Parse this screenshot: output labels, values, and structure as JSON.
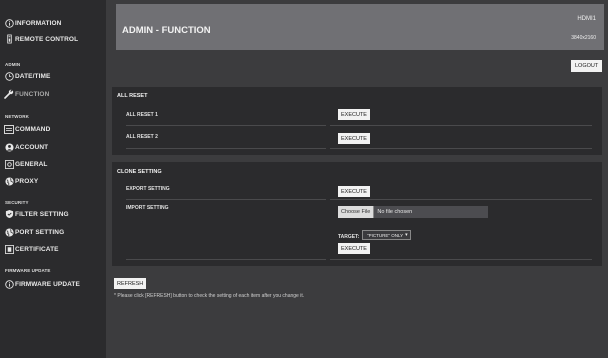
{
  "sidebar": {
    "information": "INFORMATION",
    "remote_control": "REMOTE CONTROL",
    "section_admin": "ADMIN",
    "date_time": "DATE/TIME",
    "function": "FUNCTION",
    "section_network": "NETWORK",
    "command": "COMMAND",
    "account": "ACCOUNT",
    "general": "GENERAL",
    "proxy": "PROXY",
    "section_security": "SECURITY",
    "filter_setting": "FILTER SETTING",
    "port_setting": "PORT SETTING",
    "certificate": "CERTIFICATE",
    "section_firmware": "FIRMWARE UPDATE",
    "firmware_update": "FIRMWARE UPDATE"
  },
  "header": {
    "title": "ADMIN - FUNCTION",
    "input": "HDMI1",
    "resolution": "3840x2160"
  },
  "logout_label": "LOGOUT",
  "all_reset": {
    "title": "ALL RESET",
    "row1_label": "ALL RESET 1",
    "row2_label": "ALL RESET 2",
    "execute_label": "EXECUTE"
  },
  "clone_setting": {
    "title": "CLONE SETTING",
    "export_label": "EXPORT SETTING",
    "import_label": "IMPORT SETTING",
    "execute_label": "EXECUTE",
    "choose_file_label": "Choose File",
    "no_file_text": "No file chosen",
    "target_label": "TARGET:",
    "target_value": "\"PICTURE\" ONLY"
  },
  "refresh_label": "REFRESH",
  "note": "* Please click [REFRESH] button to check the setting of each item after you change it."
}
